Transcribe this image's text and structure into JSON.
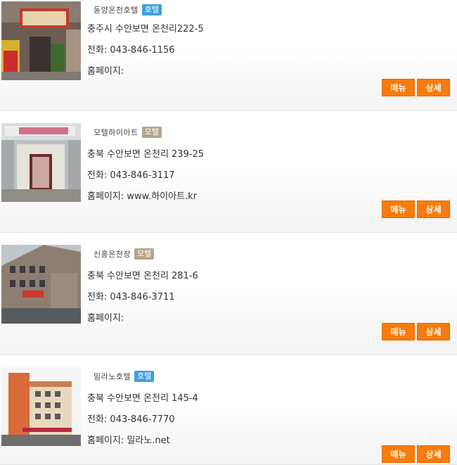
{
  "buttons": {
    "menu": "메뉴",
    "detail": "상세"
  },
  "colors": {
    "hotel_badge": "#3ea0dd",
    "motel_badge": "#b4a48c",
    "button": "#f77b0d"
  },
  "listings": [
    {
      "name": "동양온천호텔",
      "badge": "호텔",
      "badge_type": "hotel",
      "address": "충주시 수안보면 온천리222-5",
      "tel": "전화: 043-846-1156",
      "homepage": "홈페이지:"
    },
    {
      "name": "모텔하이아트",
      "badge": "모텔",
      "badge_type": "motel",
      "address": "충북 수안보면 온천리 239-25",
      "tel": "전화: 043-846-3117",
      "homepage": "홈페이지: www.하이아트.kr"
    },
    {
      "name": "신흥온천장",
      "badge": "모텔",
      "badge_type": "motel",
      "address": "충북 수안보면 온천리 281-6",
      "tel": "전화: 043-846-3711",
      "homepage": "홈페이지:"
    },
    {
      "name": "밀라노호텔",
      "badge": "호텔",
      "badge_type": "hotel",
      "address": "충북 수안보면 온천리 145-4",
      "tel": "전화: 043-846-7770",
      "homepage": "홈페이지: 밀라노.net"
    }
  ]
}
